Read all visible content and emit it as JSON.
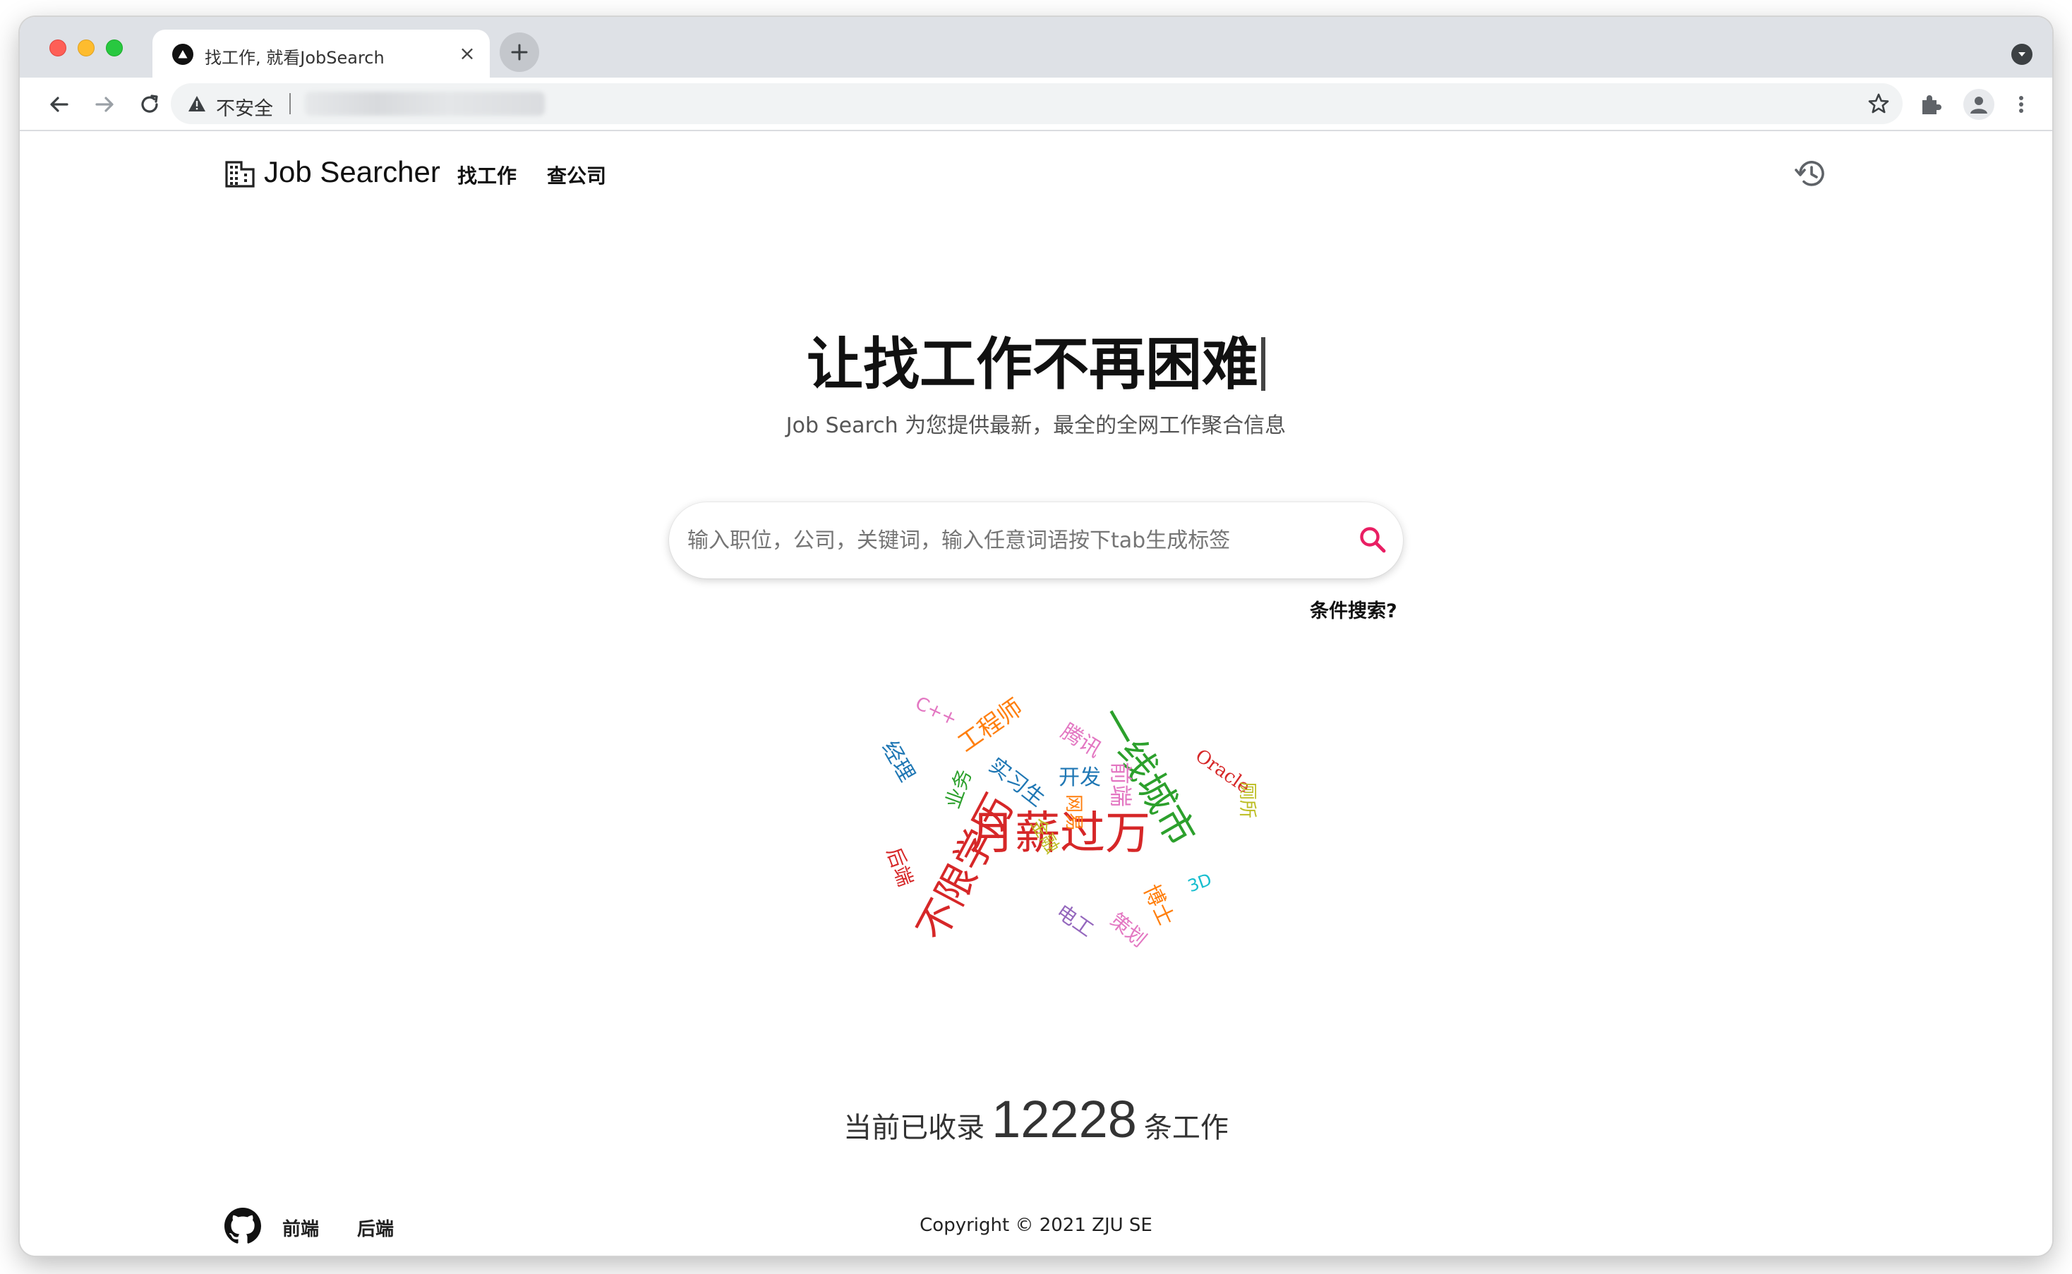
{
  "browser": {
    "tab_title": "找工作, 就看JobSearch",
    "close_glyph": "×",
    "security_label": "不安全"
  },
  "header": {
    "brand": "Job Searcher",
    "nav": [
      "找工作",
      "查公司"
    ]
  },
  "hero": {
    "title": "让找工作不再困难",
    "subtitle": "Job Search 为您提供最新，最全的全网工作聚合信息"
  },
  "search": {
    "placeholder": "输入职位，公司，关键词，输入任意词语按下tab生成标签",
    "advanced_label": "条件搜索?"
  },
  "word_cloud": {
    "words": [
      {
        "text": "月薪过万",
        "color": "#d62728"
      },
      {
        "text": "不限学历",
        "color": "#d62728"
      },
      {
        "text": "一线城市",
        "color": "#2ca02c"
      },
      {
        "text": "工程师",
        "color": "#ff7f0e"
      },
      {
        "text": "C++",
        "color": "#e377c2"
      },
      {
        "text": "经理",
        "color": "#1f77b4"
      },
      {
        "text": "腾讯",
        "color": "#e377c2"
      },
      {
        "text": "开发",
        "color": "#1f77b4"
      },
      {
        "text": "前端",
        "color": "#e377c2"
      },
      {
        "text": "实习生",
        "color": "#1f77b4"
      },
      {
        "text": "业务",
        "color": "#2ca02c"
      },
      {
        "text": "网易",
        "color": "#ff7f0e"
      },
      {
        "text": "Oracle",
        "color": "#d62728"
      },
      {
        "text": "厕所",
        "color": "#bcbd22"
      },
      {
        "text": "后端",
        "color": "#d62728"
      },
      {
        "text": "金融",
        "color": "#bcbd22"
      },
      {
        "text": "博士",
        "color": "#ff7f0e"
      },
      {
        "text": "3D",
        "color": "#17becf"
      },
      {
        "text": "电工",
        "color": "#9467bd"
      },
      {
        "text": "策划",
        "color": "#e377c2"
      }
    ]
  },
  "stats": {
    "prefix": "当前已收录",
    "count": "12228",
    "suffix": "条工作"
  },
  "footer": {
    "links": [
      "前端",
      "后端"
    ],
    "copyright": "Copyright © 2021 ZJU SE"
  },
  "colors": {
    "accent": "#e91e63",
    "tabstrip": "#dee1e6"
  }
}
